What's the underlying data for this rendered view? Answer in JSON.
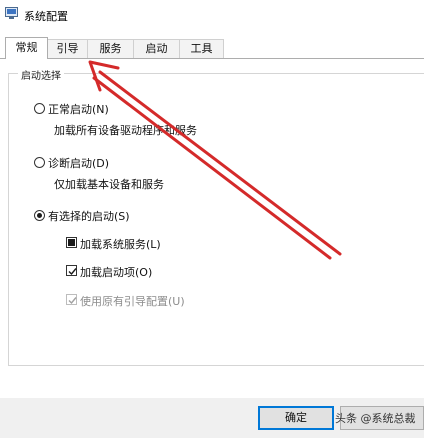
{
  "window": {
    "title": "系统配置",
    "app_icon": "system-config-icon"
  },
  "tabs": [
    {
      "label": "常规",
      "active": true
    },
    {
      "label": "引导",
      "active": false
    },
    {
      "label": "服务",
      "active": false
    },
    {
      "label": "启动",
      "active": false
    },
    {
      "label": "工具",
      "active": false
    }
  ],
  "startup_selection": {
    "legend": "启动选择",
    "normal": {
      "label": "正常启动(N)",
      "description": "加载所有设备驱动程序和服务",
      "selected": false
    },
    "diagnostic": {
      "label": "诊断启动(D)",
      "description": "仅加载基本设备和服务",
      "selected": false
    },
    "selective": {
      "label": "有选择的启动(S)",
      "selected": true,
      "options": [
        {
          "label": "加载系统服务(L)",
          "state": "indeterminate",
          "enabled": true
        },
        {
          "label": "加载启动项(O)",
          "state": "checked",
          "enabled": true
        },
        {
          "label": "使用原有引导配置(U)",
          "state": "checked",
          "enabled": false
        }
      ]
    }
  },
  "buttons": {
    "ok": "确定"
  },
  "watermark": "头条 @系统总裁",
  "annotation": {
    "type": "red-arrow",
    "color": "#d42a2a",
    "points_to": "tab-boot"
  },
  "colors": {
    "accent": "#0078d7",
    "arrow": "#d42a2a"
  }
}
